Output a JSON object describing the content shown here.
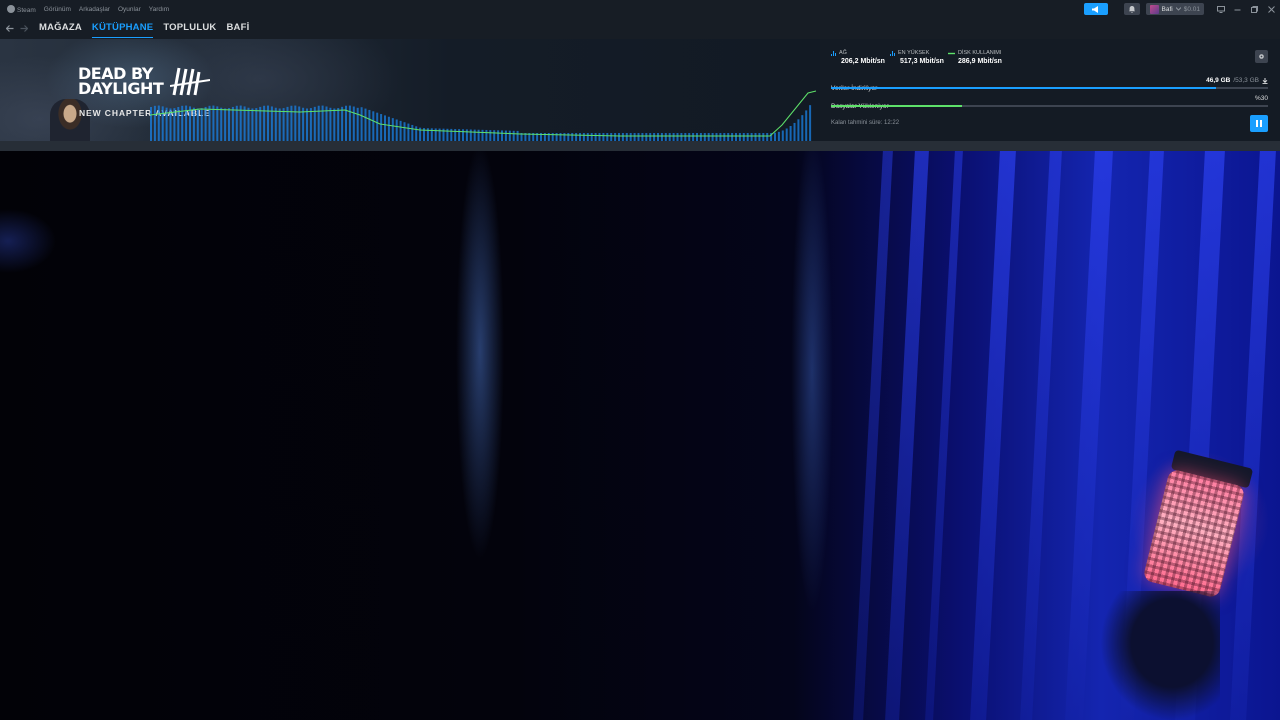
{
  "menu": {
    "items": [
      "Steam",
      "Görünüm",
      "Arkadaşlar",
      "Oyunlar",
      "Yardım"
    ]
  },
  "user": {
    "name": "Bafi",
    "wallet": "$0.01"
  },
  "nav": {
    "tabs": [
      {
        "label": "MAĞAZA",
        "active": false
      },
      {
        "label": "KÜTÜPHANE",
        "active": true
      },
      {
        "label": "TOPLULUK",
        "active": false
      },
      {
        "label": "BAFİ",
        "active": false
      }
    ]
  },
  "banner": {
    "logo_line1": "DEAD BY",
    "logo_line2": "DAYLIGHT",
    "subtitle": "NEW CHAPTER AVAILABLE"
  },
  "stats": {
    "network": {
      "label": "AĞ",
      "value": "206,2 Mbit/sn",
      "color": "#1a9fff"
    },
    "peak": {
      "label": "EN YÜKSEK",
      "value": "517,3 Mbit/sn",
      "color": "#1a9fff"
    },
    "disk": {
      "label": "DİSK KULLANIMI",
      "value": "286,9 Mbit/sn",
      "color": "#5ee26a"
    }
  },
  "progress": {
    "download": {
      "label": "Veriler İndiriliyor",
      "done": "46,9 GB",
      "total": "/53,3 GB",
      "fraction": 0.88,
      "color": "#1a9fff"
    },
    "install": {
      "label": "Dosyalar Yükleniyor",
      "percent_text": "%30",
      "fraction": 0.3,
      "color": "#5ee26a"
    },
    "eta": "Kalan tahmini süre: 12:22"
  }
}
